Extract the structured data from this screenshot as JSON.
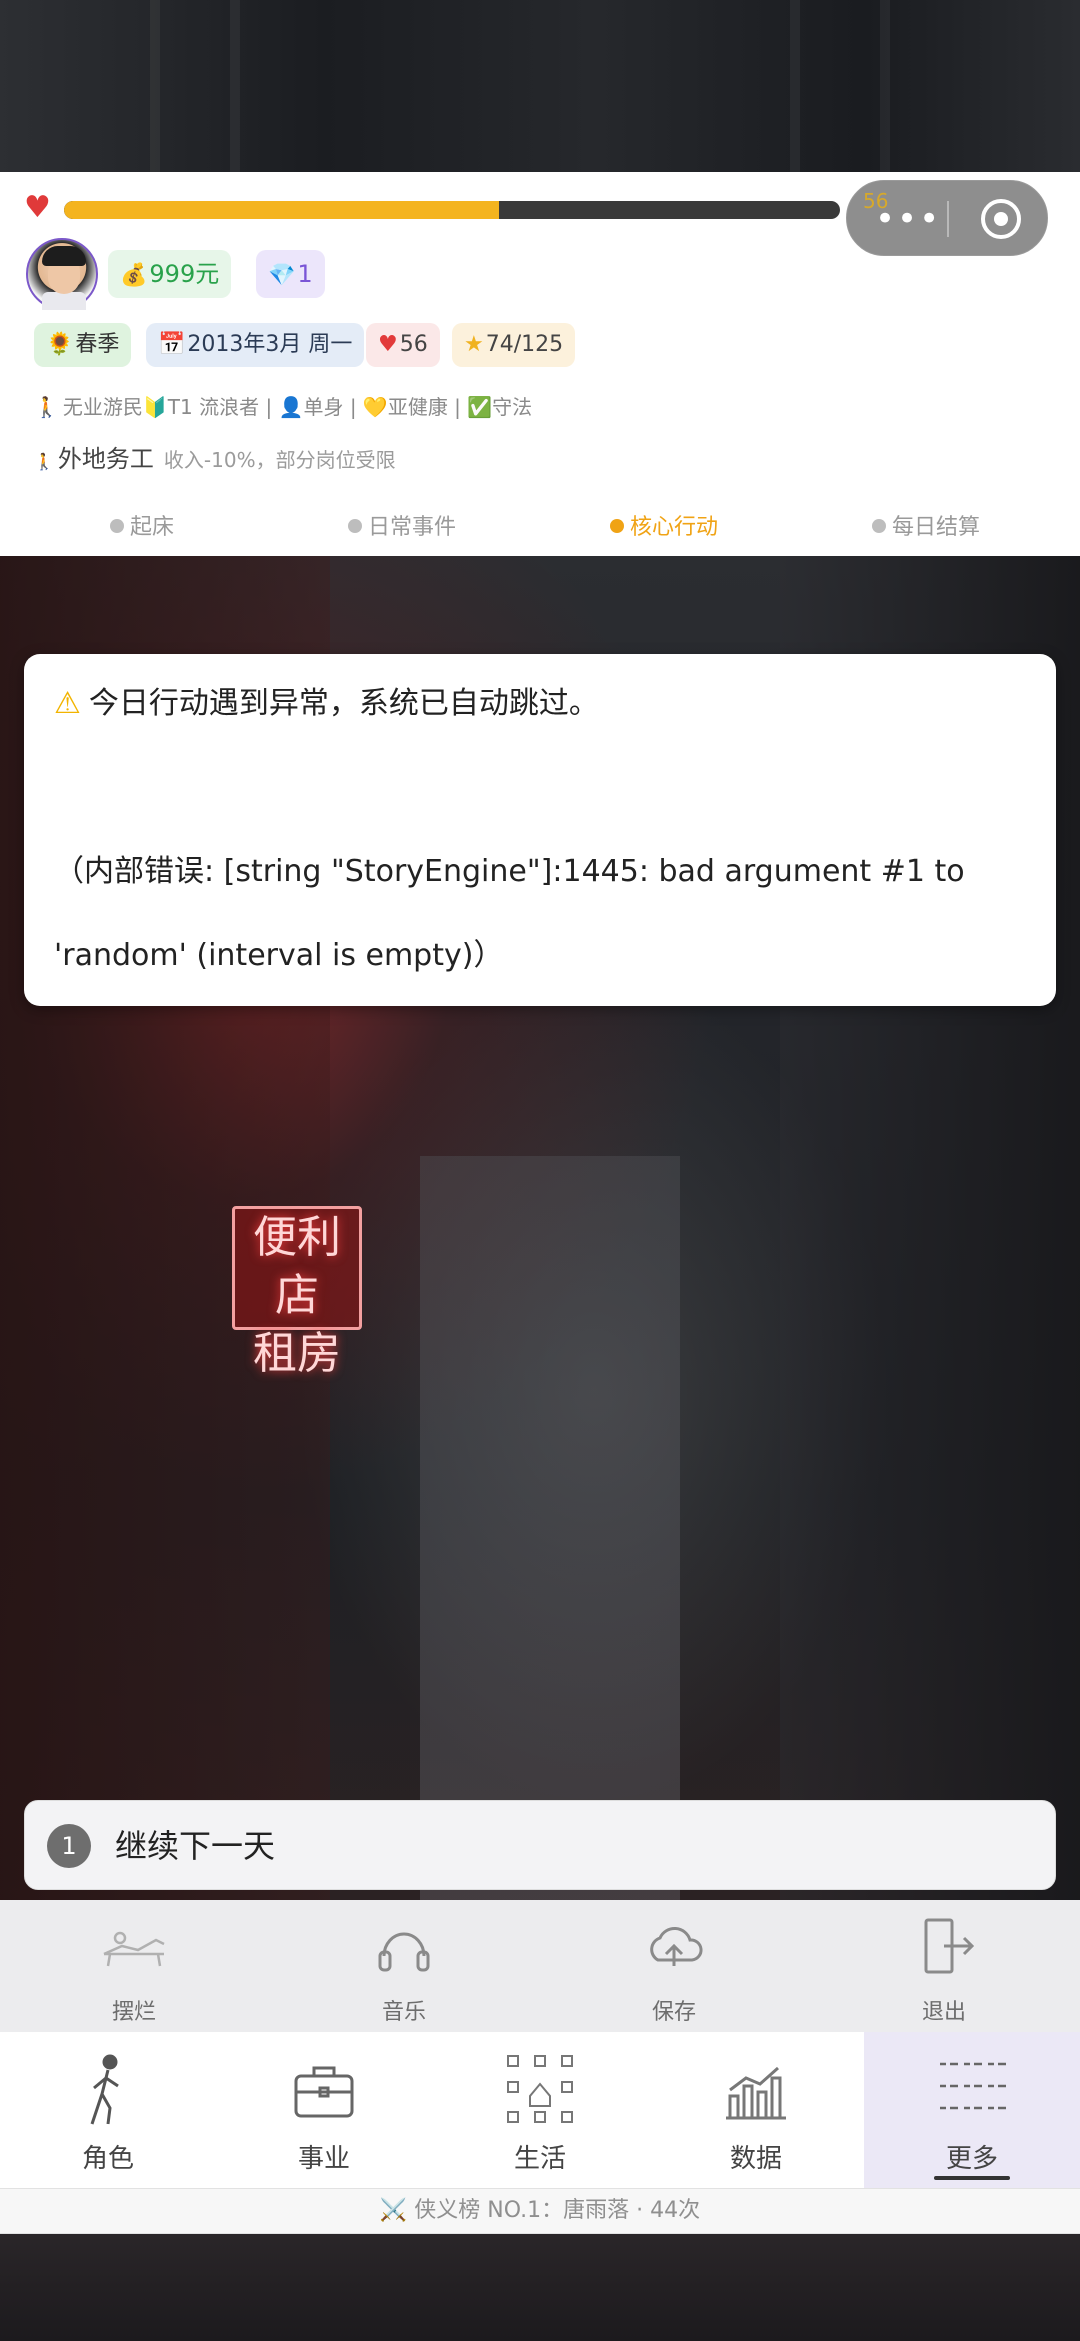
{
  "capsule": {
    "number": "56"
  },
  "player": {
    "hp_progress": 0.56,
    "money": "999元",
    "gems": "1",
    "season": "春季",
    "date": "2013年3月 周一",
    "hp": "56",
    "stars": "74/125"
  },
  "status": {
    "line": "无业游民🔰T1 流浪者 | 👤单身 | 💛亚健康 | ✅守法",
    "job_title": "外地务工",
    "job_desc": "收入-10%，部分岗位受限"
  },
  "steps": [
    "起床",
    "日常事件",
    "核心行动",
    "每日结算"
  ],
  "active_step": 2,
  "sign": {
    "line1": "便利店",
    "line2": "租房"
  },
  "dialog": {
    "title": "今日行动遇到异常，系统已自动跳过。",
    "error": "（内部错误: [string \"StoryEngine\"]:1445: bad argument #1 to 'random' (interval is empty)）"
  },
  "choice": {
    "number": "1",
    "label": "继续下一天"
  },
  "utilities": [
    {
      "label": "摆烂",
      "icon": "lounge-chair-icon"
    },
    {
      "label": "音乐",
      "icon": "headphones-icon"
    },
    {
      "label": "保存",
      "icon": "cloud-upload-icon"
    },
    {
      "label": "退出",
      "icon": "exit-door-icon"
    }
  ],
  "tabs": [
    {
      "label": "角色",
      "icon": "walking-person-icon"
    },
    {
      "label": "事业",
      "icon": "briefcase-icon"
    },
    {
      "label": "生活",
      "icon": "life-grid-icon"
    },
    {
      "label": "数据",
      "icon": "bar-chart-icon"
    },
    {
      "label": "更多",
      "icon": "list-menu-icon"
    }
  ],
  "active_tab": 4,
  "rank": "侠义榜 NO.1：唐雨落 · 44次",
  "colors": {
    "accent": "#f0a315",
    "hp_bar": "#f4b41f",
    "money": "#29a24b",
    "gem": "#7a55d6",
    "heart": "#e03a3a"
  }
}
